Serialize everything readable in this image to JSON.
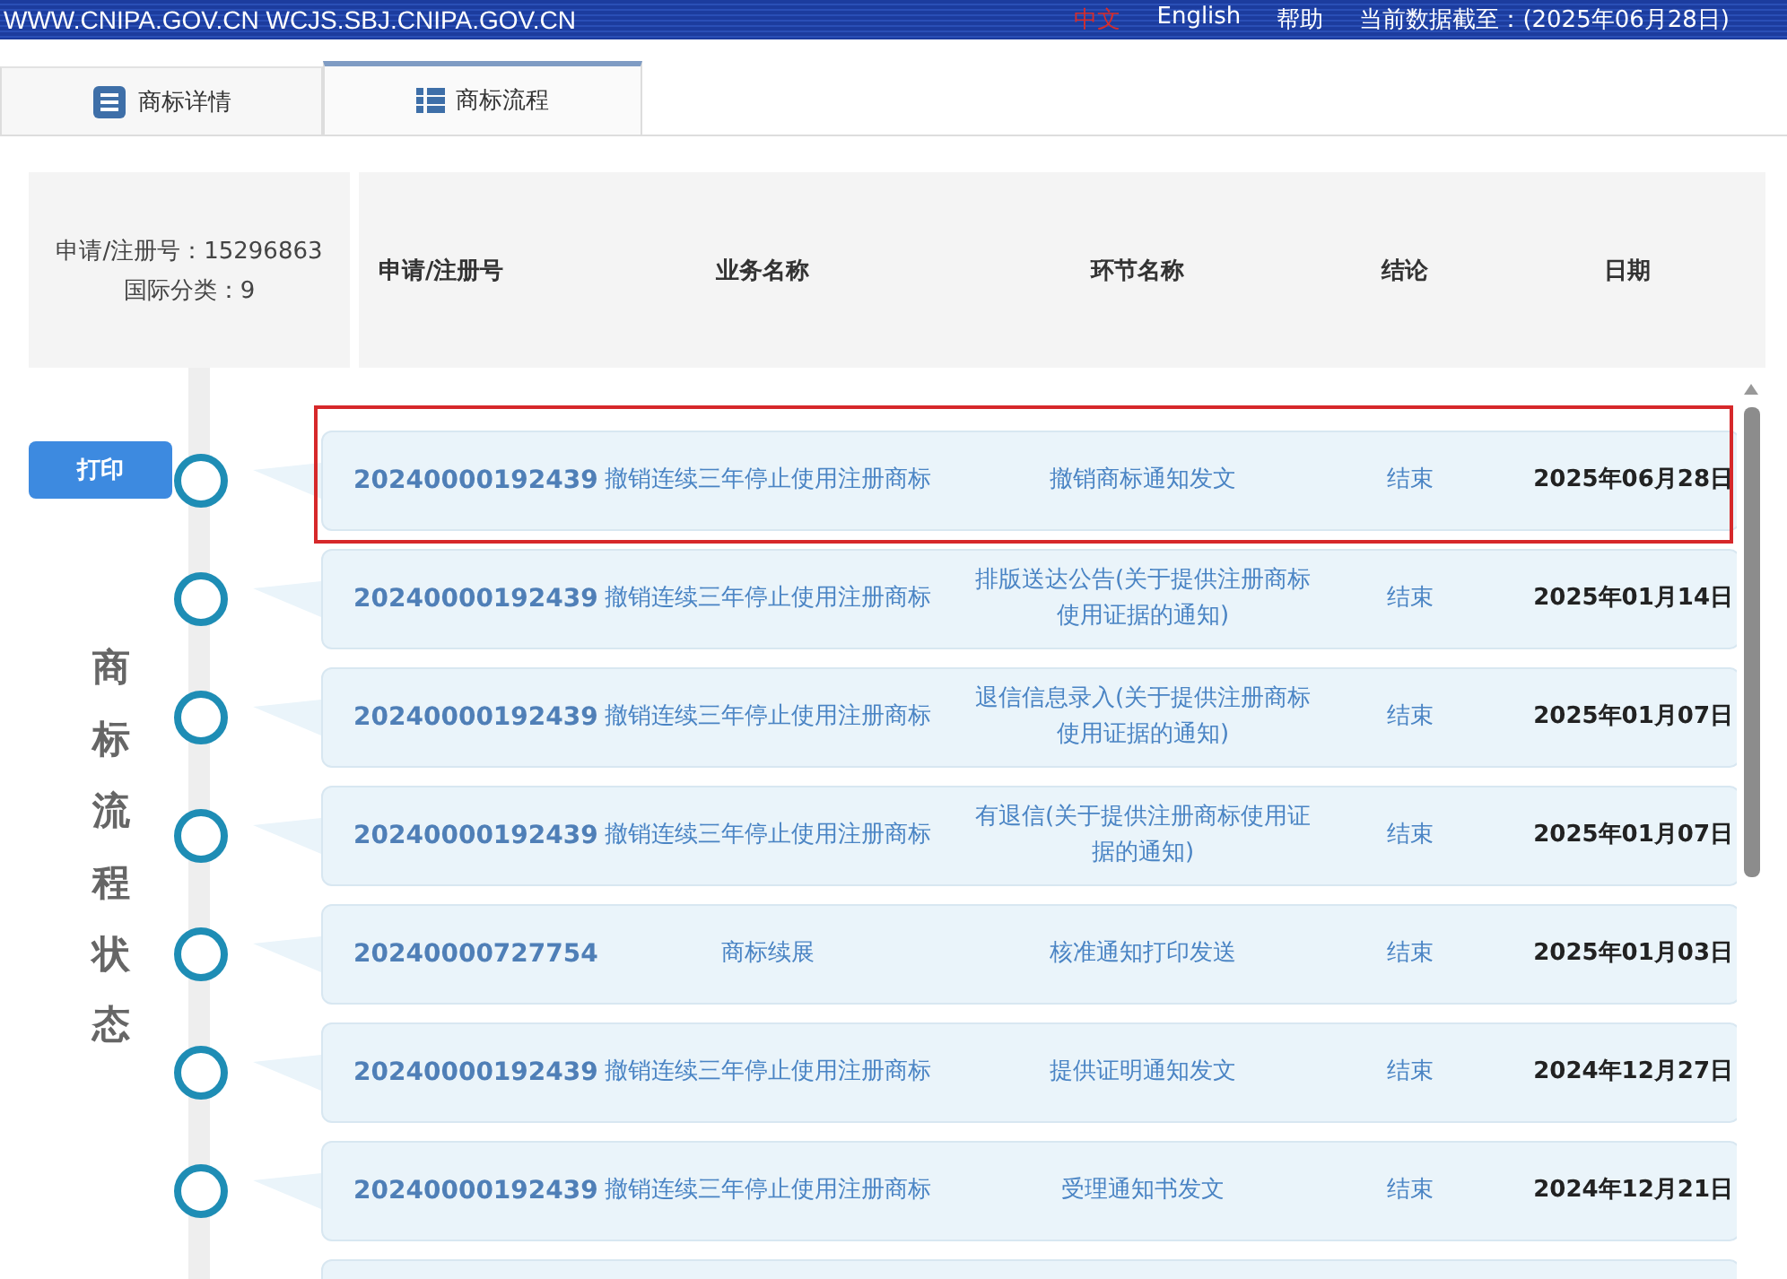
{
  "top_bar": {
    "site_links": "WWW.CNIPA.GOV.CN WCJS.SBJ.CNIPA.GOV.CN",
    "languages": [
      {
        "label": "中文",
        "selected": true
      },
      {
        "label": "English",
        "selected": false
      }
    ],
    "help": "帮助",
    "data_date": "当前数据截至：(2025年06月28日)"
  },
  "tabs": [
    {
      "label": "商标详情",
      "selected": false
    },
    {
      "label": "商标流程",
      "selected": true
    }
  ],
  "mark_info": {
    "number": "申请/注册号：15296863",
    "class": "国际分类：9"
  },
  "print_button": "打印",
  "side_title": "商标流程状态",
  "columns": [
    "申请/注册号",
    "业务名称",
    "环节名称",
    "结论",
    "日期"
  ],
  "rows": [
    {
      "number": "20240000192439",
      "business": "撤销连续三年停止使用注册商标",
      "stage": "撤销商标通知发文",
      "result": "结束",
      "date": "2025年06月28日",
      "highlighted": true
    },
    {
      "number": "20240000192439",
      "business": "撤销连续三年停止使用注册商标",
      "stage": "排版送达公告(关于提供注册商标使用证据的通知)",
      "result": "结束",
      "date": "2025年01月14日",
      "highlighted": false
    },
    {
      "number": "20240000192439",
      "business": "撤销连续三年停止使用注册商标",
      "stage": "退信信息录入(关于提供注册商标使用证据的通知)",
      "result": "结束",
      "date": "2025年01月07日",
      "highlighted": false
    },
    {
      "number": "20240000192439",
      "business": "撤销连续三年停止使用注册商标",
      "stage": "有退信(关于提供注册商标使用证据的通知)",
      "result": "结束",
      "date": "2025年01月07日",
      "highlighted": false
    },
    {
      "number": "20240000727754",
      "business": "商标续展",
      "stage": "核准通知打印发送",
      "result": "结束",
      "date": "2025年01月03日",
      "highlighted": false
    },
    {
      "number": "20240000192439",
      "business": "撤销连续三年停止使用注册商标",
      "stage": "提供证明通知发文",
      "result": "结束",
      "date": "2024年12月27日",
      "highlighted": false
    },
    {
      "number": "20240000192439",
      "business": "撤销连续三年停止使用注册商标",
      "stage": "受理通知书发文",
      "result": "结束",
      "date": "2024年12月21日",
      "highlighted": false
    }
  ]
}
